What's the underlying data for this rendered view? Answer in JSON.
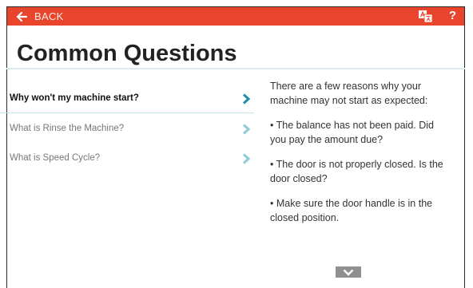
{
  "header": {
    "back_label": "BACK",
    "help_label": "?",
    "accent_color": "#e8452c"
  },
  "page": {
    "title": "Common Questions"
  },
  "questions": [
    {
      "label": "Why won't my machine start?",
      "active": true
    },
    {
      "label": "What is Rinse the Machine?",
      "active": false
    },
    {
      "label": "What is Speed Cycle?",
      "active": false
    }
  ],
  "answer": {
    "paragraphs": [
      "There are a few reasons why your machine may not start as expected:",
      "• The balance has not been paid. Did you pay the amount due?",
      "• The door is not properly closed. Is the door closed?",
      "• Make sure the door handle is in the closed position."
    ]
  },
  "icons": {
    "back": "arrow-left-icon",
    "translate": "translate-icon",
    "chevron": "chevron-right-icon",
    "scroll": "chevron-down-icon"
  }
}
